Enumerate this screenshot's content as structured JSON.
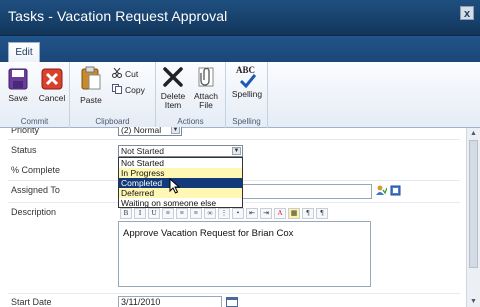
{
  "window": {
    "title": "Tasks - Vacation Request Approval",
    "close": "x"
  },
  "ribbon": {
    "tab": "Edit",
    "groups": {
      "commit": {
        "label": "Commit",
        "save": "Save",
        "cancel": "Cancel"
      },
      "clipboard": {
        "label": "Clipboard",
        "paste": "Paste",
        "cut": "Cut",
        "copy": "Copy"
      },
      "actions": {
        "label": "Actions",
        "delete_l1": "Delete",
        "delete_l2": "Item",
        "attach_l1": "Attach",
        "attach_l2": "File"
      },
      "spelling": {
        "label": "Spelling",
        "spelling": "Spelling",
        "abc": "ABC"
      }
    }
  },
  "form": {
    "priority": {
      "label": "Priority",
      "value": "(2) Normal"
    },
    "status": {
      "label": "Status",
      "value": "Not Started",
      "options": [
        "Not Started",
        "In Progress",
        "Completed",
        "Deferred",
        "Waiting on someone else"
      ],
      "highlighted_index": 2
    },
    "percent_complete": {
      "label": "% Complete"
    },
    "assigned_to": {
      "label": "Assigned To"
    },
    "description": {
      "label": "Description",
      "value": "Approve Vacation Request for Brian Cox"
    },
    "start_date": {
      "label": "Start Date",
      "value": "3/11/2010"
    }
  },
  "colors": {
    "titlebar": "#17406b",
    "selection": "#123a7a",
    "highlight": "#ffee1e"
  }
}
